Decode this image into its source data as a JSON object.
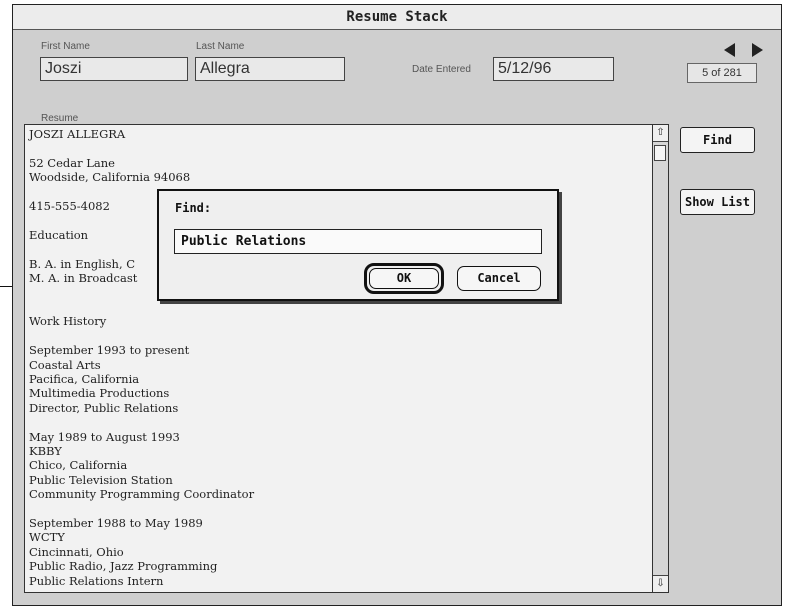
{
  "window": {
    "title": "Resume Stack"
  },
  "fields": {
    "first_name": {
      "label": "First Name",
      "value": "Joszi"
    },
    "last_name": {
      "label": "Last Name",
      "value": "Allegra"
    },
    "date_entered": {
      "label": "Date Entered",
      "value": "5/12/96"
    }
  },
  "navigation": {
    "prev_icon": "left-arrow-icon",
    "next_icon": "right-arrow-icon",
    "record_counter": "5 of 281"
  },
  "resume": {
    "label": "Resume",
    "text": "JOSZI ALLEGRA\n\n52 Cedar Lane\nWoodside, California 94068\n\n415-555-4082\n\nEducation\n\nB. A. in English, C\nM. A. in Broadcast\n\n\nWork History\n\nSeptember 1993 to present\nCoastal Arts\nPacifica, California\nMultimedia Productions\nDirector, Public Relations\n\nMay 1989 to August 1993\nKBBY\nChico, California\nPublic Television Station\nCommunity Programming Coordinator\n\nSeptember 1988 to May 1989\nWCTY\nCincinnati, Ohio\nPublic Radio, Jazz Programming\nPublic Relations Intern"
  },
  "scrollbar": {
    "up_icon": "scroll-up-arrow-icon",
    "down_icon": "scroll-down-arrow-icon"
  },
  "buttons": {
    "find": "Find",
    "show_list": "Show List"
  },
  "find_dialog": {
    "label": "Find:",
    "input_value": "Public Relations",
    "ok": "OK",
    "cancel": "Cancel"
  }
}
